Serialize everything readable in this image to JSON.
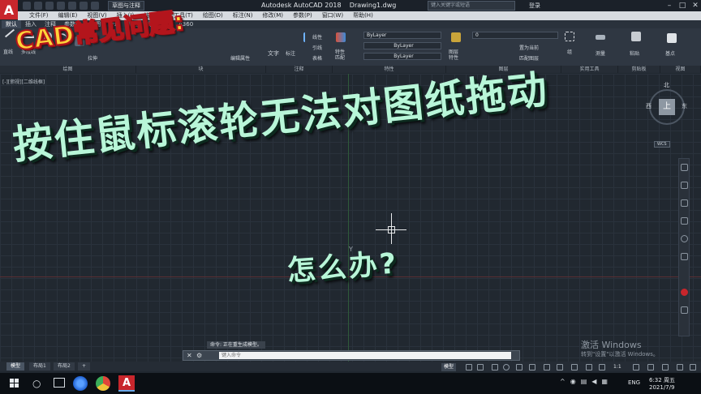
{
  "titlebar": {
    "workspace": "草图与注释",
    "window_title": "Autodesk AutoCAD 2018    Drawing1.dwg",
    "search_placeholder": "键入关键字或短语",
    "signin": "登录",
    "logo": "A"
  },
  "menu": [
    "文件(F)",
    "编辑(E)",
    "视图(V)",
    "插入(I)",
    "格式(O)",
    "工具(T)",
    "绘图(D)",
    "标注(N)",
    "修改(M)",
    "参数(P)",
    "窗口(W)",
    "帮助(H)"
  ],
  "ribbon_tabs": [
    "默认",
    "插入",
    "注释",
    "参数化",
    "视图",
    "管理",
    "输出",
    "附加模块",
    "A360"
  ],
  "ribbon": {
    "draw": {
      "line": "直线",
      "polyline": "多段线"
    },
    "modify": {
      "move": "移动",
      "stretch": "拉伸"
    },
    "block": {
      "edit_attr": "编辑属性"
    },
    "annotation": {
      "text": "文字",
      "dimension": "标注",
      "linear": "线性",
      "leader": "引线",
      "table": "表格"
    },
    "properties": {
      "match": "特性\n匹配",
      "bylayer1": "ByLayer",
      "bylayer2": "ByLayer",
      "bylayer3": "ByLayer"
    },
    "layers": {
      "layer_props": "图层\n特性",
      "layer_value": "0",
      "set_current": "置为当前",
      "match_layer": "匹配图层"
    },
    "groups": {
      "group": "组",
      "measure": "测量",
      "paste": "粘贴",
      "base": "基点"
    },
    "panel_labels": {
      "draw": "绘图",
      "block": "块",
      "annotation": "注释",
      "properties": "特性",
      "layers": "图层",
      "utilities": "实用工具",
      "clipboard": "剪贴板",
      "view": "视图"
    }
  },
  "viewport": {
    "label": "[-][俯视][二维线框]",
    "cube_top": "上",
    "compass_north": "北",
    "compass_east": "东",
    "compass_west": "西",
    "wcs": "WCS",
    "ucs": "Y"
  },
  "overlay": {
    "title": "CAD常见问题:",
    "main": "按住鼠标滚轮无法对图纸拖动",
    "sub": "怎么办?"
  },
  "watermark": {
    "title": "激活 Windows",
    "desc": "转到\"设置\"以激活 Windows。"
  },
  "command": {
    "history": "命令: 正在重生成模型。",
    "placeholder": "键入命令"
  },
  "layout_tabs": [
    "模型",
    "布局1",
    "布局2"
  ],
  "status": {
    "model": "模型",
    "scale": "1:1"
  },
  "taskbar": {
    "ime": "ENG",
    "time": "6:32 周五",
    "date": "2021/7/9"
  },
  "colors": {
    "autocad_red": "#c8262c",
    "title_yellow": "#ffd43a",
    "overlay_green": "#b8f6d8"
  }
}
